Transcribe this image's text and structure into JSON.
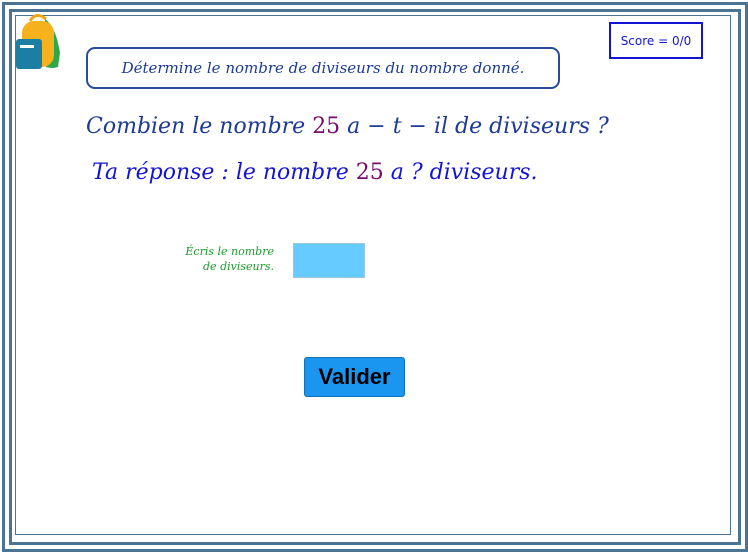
{
  "instruction": "Détermine le nombre de diviseurs du nombre donné.",
  "score": "Score = 0/0",
  "question": {
    "prefix": "Combien le nombre ",
    "number": "25",
    "suffix": " a − t − il de diviseurs ?"
  },
  "answer_line": {
    "prefix": "Ta réponse : le nombre ",
    "number": "25",
    "suffix": " a ? diviseurs."
  },
  "hint": {
    "line1": "Écris le nombre",
    "line2": "de diviseurs."
  },
  "answer_input": {
    "value": ""
  },
  "validate_label": "Valider",
  "colors": {
    "frame": "#4a7394",
    "text_blue": "#1c3a96",
    "number_purple": "#7a0a6e",
    "hint_green": "#1b9b2a",
    "input_bg": "#66ccff",
    "button_bg": "#1a95f0"
  },
  "icons": {
    "logo": "backpack-icon"
  }
}
